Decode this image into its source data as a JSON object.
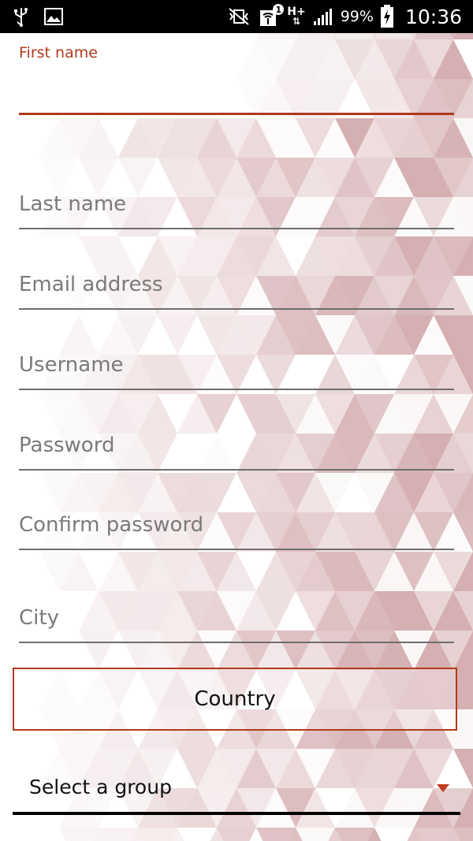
{
  "status_bar": {
    "icons_left": [
      "usb-icon",
      "image-icon"
    ],
    "icons_right": [
      "vibrate-mute-icon",
      "hotspot-icon",
      "data-hplus-icon",
      "signal-icon",
      "battery-charging-icon"
    ],
    "hotspot_badge": "1",
    "network_type": "H+",
    "battery": "99%",
    "time": "10:36"
  },
  "form": {
    "first_name": {
      "label": "First name",
      "value": ""
    },
    "last_name": {
      "placeholder": "Last name"
    },
    "email": {
      "placeholder": "Email address"
    },
    "username": {
      "placeholder": "Username"
    },
    "password": {
      "placeholder": "Password"
    },
    "confirm_password": {
      "placeholder": "Confirm password"
    },
    "city": {
      "placeholder": "City"
    },
    "country_button": "Country",
    "group_select": {
      "selected": "Select a group"
    }
  },
  "colors": {
    "accent": "#b03a1e",
    "background_pattern": "#c9989c"
  }
}
